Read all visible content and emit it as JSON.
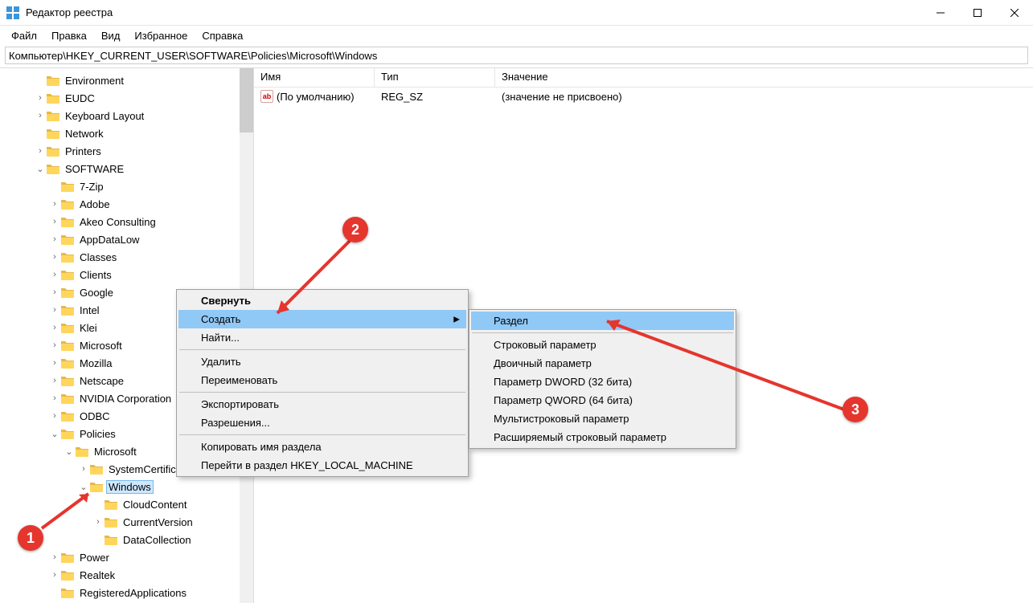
{
  "window": {
    "title": "Редактор реестра"
  },
  "menu": {
    "file": "Файл",
    "edit": "Правка",
    "view": "Вид",
    "favorites": "Избранное",
    "help": "Справка"
  },
  "address": "Компьютер\\HKEY_CURRENT_USER\\SOFTWARE\\Policies\\Microsoft\\Windows",
  "list": {
    "headers": {
      "name": "Имя",
      "type": "Тип",
      "value": "Значение"
    },
    "rows": [
      {
        "name": "(По умолчанию)",
        "type": "REG_SZ",
        "value": "(значение не присвоено)"
      }
    ]
  },
  "tree": {
    "Environment": "Environment",
    "EUDC": "EUDC",
    "KeyboardLayout": "Keyboard Layout",
    "Network": "Network",
    "Printers": "Printers",
    "SOFTWARE": "SOFTWARE",
    "SevenZip": "7-Zip",
    "Adobe": "Adobe",
    "Akeo": "Akeo Consulting",
    "AppDataLow": "AppDataLow",
    "Classes": "Classes",
    "Clients": "Clients",
    "Google": "Google",
    "Intel": "Intel",
    "Klei": "Klei",
    "Microsoft": "Microsoft",
    "Mozilla": "Mozilla",
    "Netscape": "Netscape",
    "NVIDIA": "NVIDIA Corporation",
    "ODBC": "ODBC",
    "Policies": "Policies",
    "MicrosoftP": "Microsoft",
    "SystemCert": "SystemCertificates",
    "Windows": "Windows",
    "CloudContent": "CloudContent",
    "CurrentVersion": "CurrentVersion",
    "DataCollection": "DataCollection",
    "Power": "Power",
    "Realtek": "Realtek",
    "RegisteredApplications": "RegisteredApplications"
  },
  "ctx1": {
    "collapse": "Свернуть",
    "create": "Создать",
    "find": "Найти...",
    "delete": "Удалить",
    "rename": "Переименовать",
    "export": "Экспортировать",
    "permissions": "Разрешения...",
    "copyKeyName": "Копировать имя раздела",
    "goToHKLM": "Перейти в раздел HKEY_LOCAL_MACHINE"
  },
  "ctx2": {
    "key": "Раздел",
    "string": "Строковый параметр",
    "binary": "Двоичный параметр",
    "dword": "Параметр DWORD (32 бита)",
    "qword": "Параметр QWORD (64 бита)",
    "multistring": "Мультистроковый параметр",
    "expandstring": "Расширяемый строковый параметр"
  },
  "badges": {
    "b1": "1",
    "b2": "2",
    "b3": "3"
  }
}
